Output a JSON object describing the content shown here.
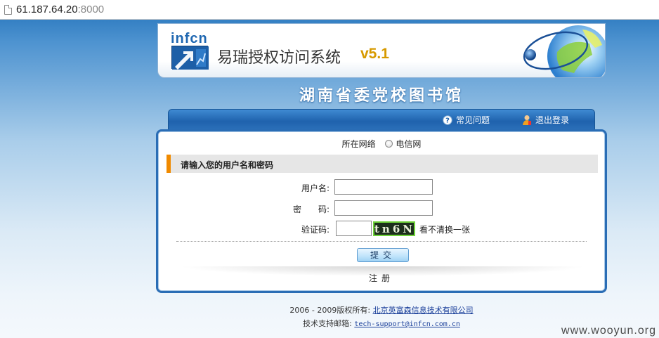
{
  "browser": {
    "url_host": "61.187.64.20",
    "url_port": ":8000"
  },
  "header": {
    "logo_text": "infcn",
    "system_title": "易瑞授权访问系统",
    "version": "v5.1",
    "library_name": "湖南省委党校图书馆"
  },
  "nav": {
    "faq_label": "常见问题",
    "logout_label": "退出登录"
  },
  "form": {
    "network_label": "所在网络",
    "network_option": "电信网",
    "section_title": "请输入您的用户名和密码",
    "username_label": "用户名:",
    "username_value": "",
    "password_label": "密　　码:",
    "password_value": "",
    "captcha_label": "验证码:",
    "captcha_value": "",
    "captcha_image_text": "tn6N",
    "captcha_refresh": "看不清换一张",
    "submit_label": "提交",
    "register_label": "注册"
  },
  "footer": {
    "copyright_prefix": "2006 - 2009版权所有:",
    "company": "北京英富森信息技术有限公司",
    "support_prefix": "技术支持邮箱:",
    "support_email": "tech-support@infcn.com.cn"
  },
  "watermark": "www.wooyun.org",
  "colors": {
    "brand_blue": "#1f62ad",
    "accent_orange": "#f08a00",
    "version_gold": "#d79a00"
  }
}
